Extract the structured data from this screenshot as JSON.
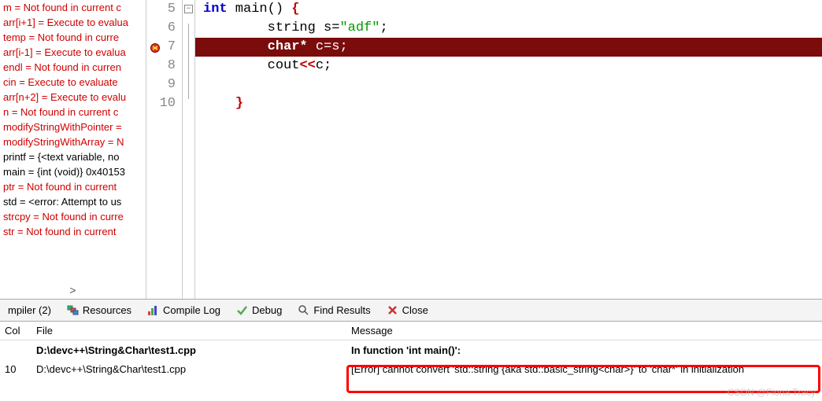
{
  "watch": {
    "items": [
      {
        "text": "m = Not found in current c",
        "cls": "red"
      },
      {
        "text": "arr[i+1] = Execute to evalua",
        "cls": "red"
      },
      {
        "text": "temp = Not found in curre",
        "cls": "red"
      },
      {
        "text": "arr[i-1] = Execute to evalua",
        "cls": "red"
      },
      {
        "text": "endl = Not found in curren",
        "cls": "red"
      },
      {
        "text": "cin = Execute to evaluate",
        "cls": "red"
      },
      {
        "text": "arr[n+2] = Execute to evalu",
        "cls": "red"
      },
      {
        "text": "n = Not found in current c",
        "cls": "red"
      },
      {
        "text": "modifyStringWithPointer =",
        "cls": "red"
      },
      {
        "text": "modifyStringWithArray = N",
        "cls": "red"
      },
      {
        "text": "printf = {<text variable, no",
        "cls": "black"
      },
      {
        "text": "main = {int (void)} 0x40153",
        "cls": "black"
      },
      {
        "text": "ptr = Not found in current ",
        "cls": "red"
      },
      {
        "text": "std = <error: Attempt to us",
        "cls": "black"
      },
      {
        "text": "strcpy = Not found in curre",
        "cls": "red"
      },
      {
        "text": "str = Not found in current ",
        "cls": "red"
      }
    ],
    "scroll_glyph": ">"
  },
  "editor": {
    "lines": [
      {
        "num": "5",
        "fold": "box"
      },
      {
        "num": "6",
        "fold": "line"
      },
      {
        "num": "7",
        "fold": "line",
        "bp": true
      },
      {
        "num": "8",
        "fold": "line"
      },
      {
        "num": "9",
        "fold": "line"
      },
      {
        "num": "10",
        "fold": "none"
      }
    ],
    "code": {
      "l5": {
        "kw": "int",
        "rest": " main() ",
        "br": "{"
      },
      "l6": {
        "indent": "        ",
        "t1": "string s=",
        "str": "\"adf\"",
        "t2": ";"
      },
      "l7": {
        "indent": "        ",
        "kw": "char*",
        "rest": " c=s;"
      },
      "l8": {
        "indent": "        ",
        "t1": "cout",
        "op": "<<",
        "t2": "c;"
      },
      "l9": {
        "indent": "        "
      },
      "l10": {
        "indent": "    ",
        "br": "}"
      }
    }
  },
  "tabs": {
    "compiler": "mpiler (2)",
    "resources": "Resources",
    "compile_log": "Compile Log",
    "debug": "Debug",
    "find_results": "Find Results",
    "close": "Close"
  },
  "table": {
    "headers": {
      "col": "Col",
      "file": "File",
      "message": "Message"
    },
    "rows": [
      {
        "col": "",
        "file": "D:\\devc++\\String&Char\\test1.cpp",
        "message": "In function 'int main()':",
        "bold": true
      },
      {
        "col": "10",
        "file": "D:\\devc++\\String&Char\\test1.cpp",
        "message": "[Error] cannot convert 'std::string {aka std::basic_string<char>}' to 'char*' in initialization",
        "bold": false
      }
    ]
  },
  "watermark": "CSDN @Fiona Tracy"
}
